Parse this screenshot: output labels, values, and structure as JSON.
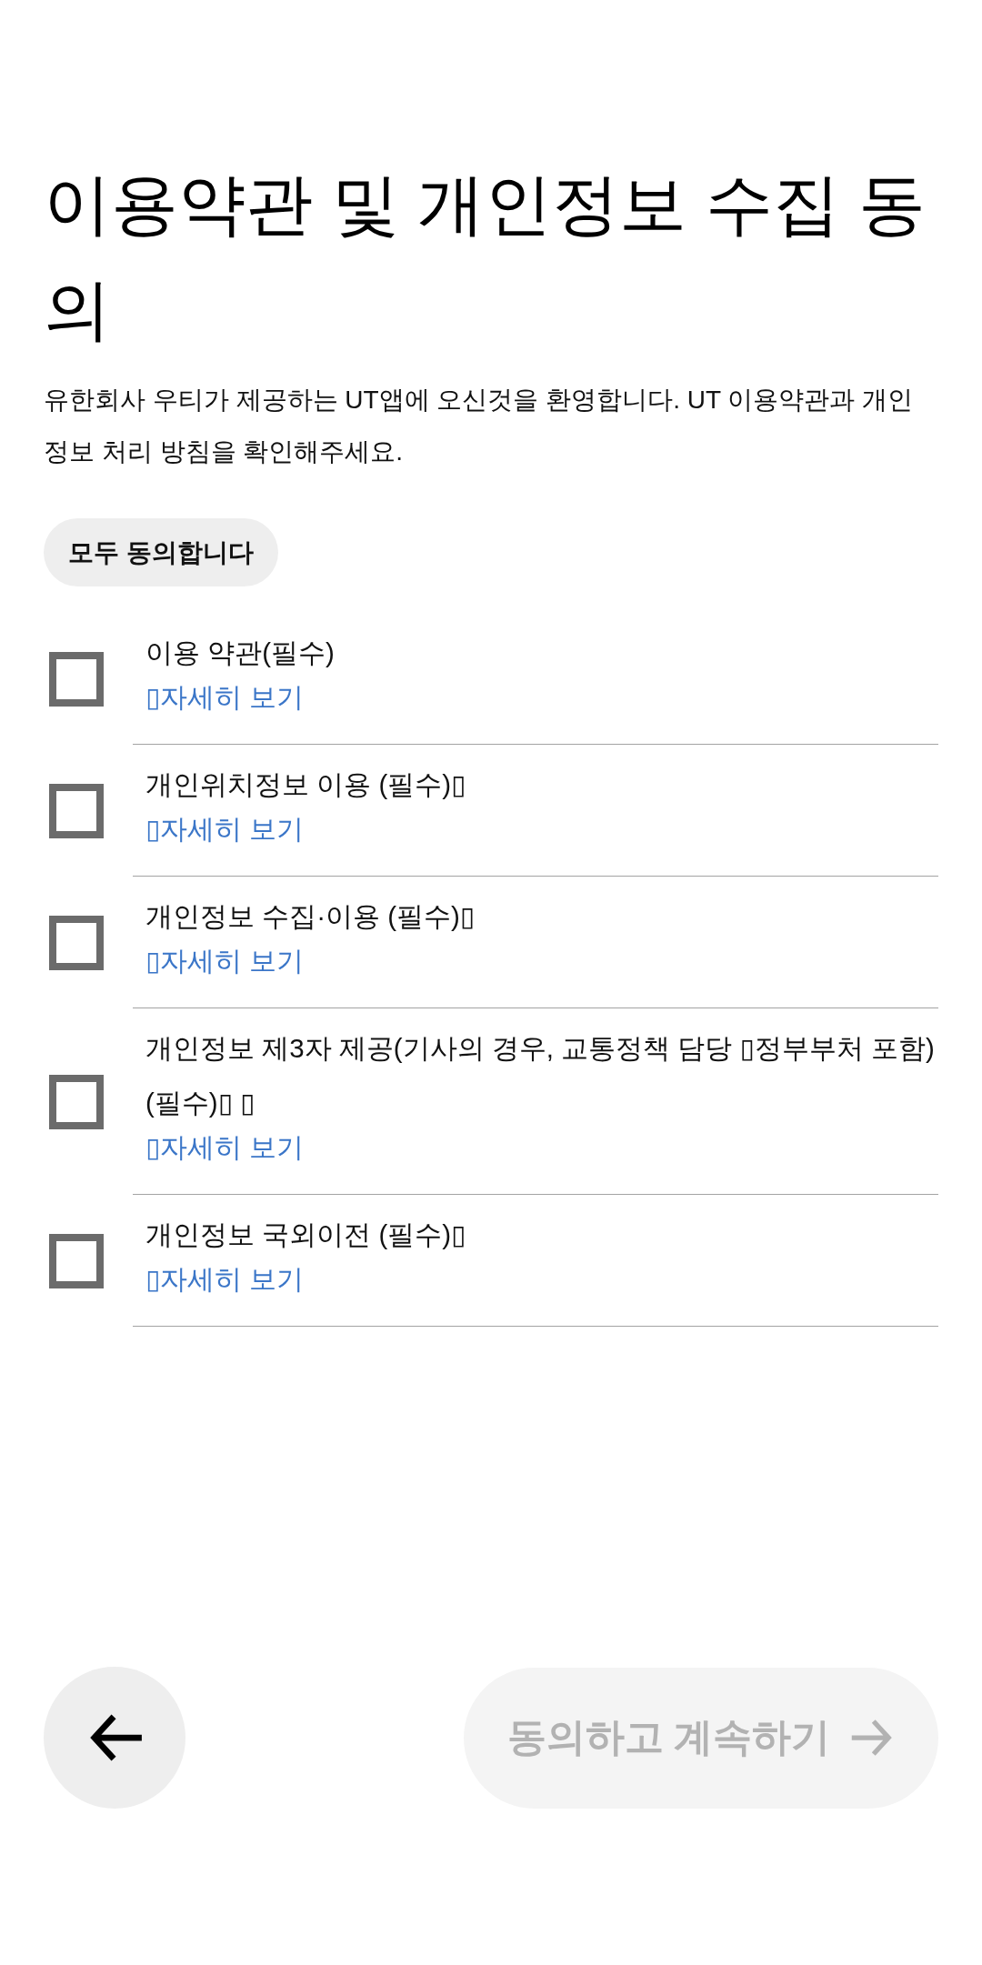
{
  "title": "이용약관 및 개인정보 수집 동의",
  "description": "유한회사 우티가 제공하는 UT앱에 오신것을 환영합니다. UT 이용약관과 개인정보 처리 방침을 확인해주세요.",
  "agree_all_button": {
    "label": "모두 동의합니다"
  },
  "items": [
    {
      "label": "이용 약관(필수)",
      "link": "▯자세히 보기",
      "checked": false
    },
    {
      "label": "개인위치정보 이용 (필수)▯",
      "link": "▯자세히 보기",
      "checked": false
    },
    {
      "label": "개인정보 수집·이용 (필수)▯",
      "link": "▯자세히 보기",
      "checked": false
    },
    {
      "label": "개인정보 제3자 제공(기사의 경우, 교통정책 담당 ▯정부부처 포함)(필수)▯ ▯",
      "link": "▯자세히 보기",
      "checked": false
    },
    {
      "label": "개인정보 국외이전 (필수)▯",
      "link": "▯자세히 보기",
      "checked": false
    }
  ],
  "continue_button": {
    "label": "동의하고 계속하기",
    "disabled": true
  }
}
